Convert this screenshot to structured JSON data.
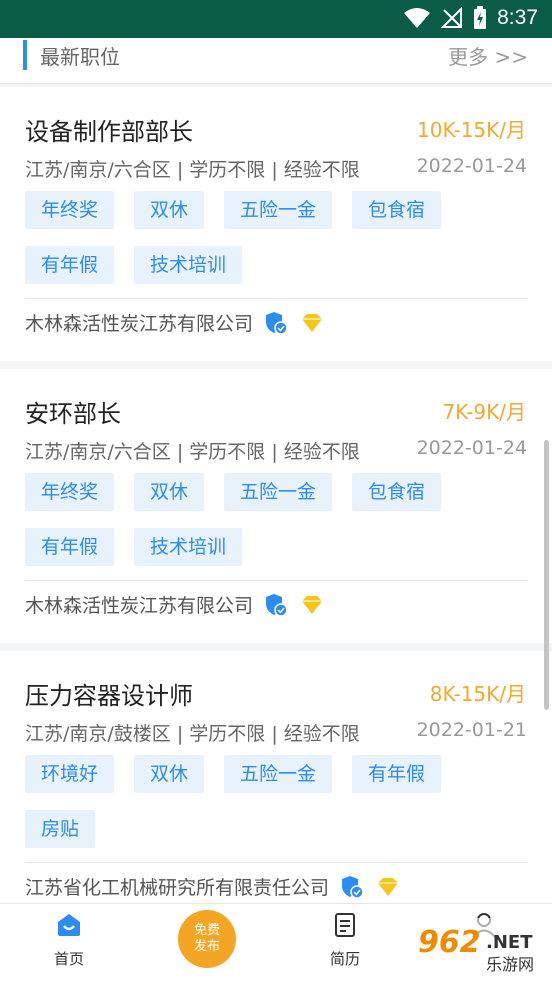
{
  "status_bar": {
    "time": "8:37"
  },
  "section": {
    "title": "最新职位",
    "more": "更多 >>"
  },
  "jobs": [
    {
      "title": "设备制作部部长",
      "salary": "10K-15K/月",
      "meta": "江苏/南京/六合区 | 学历不限 | 经验不限",
      "date": "2022-01-24",
      "tags": [
        "年终奖",
        "双休",
        "五险一金",
        "包食宿",
        "有年假",
        "技术培训"
      ],
      "company": "木林森活性炭江苏有限公司"
    },
    {
      "title": "安环部长",
      "salary": "7K-9K/月",
      "meta": "江苏/南京/六合区 | 学历不限 | 经验不限",
      "date": "2022-01-24",
      "tags": [
        "年终奖",
        "双休",
        "五险一金",
        "包食宿",
        "有年假",
        "技术培训"
      ],
      "company": "木林森活性炭江苏有限公司"
    },
    {
      "title": "压力容器设计师",
      "salary": "8K-15K/月",
      "meta": "江苏/南京/鼓楼区 | 学历不限 | 经验不限",
      "date": "2022-01-21",
      "tags": [
        "环境好",
        "双休",
        "五险一金",
        "有年假",
        "房贴"
      ],
      "company": "江苏省化工机械研究所有限责任公司"
    }
  ],
  "tabbar": {
    "home": "首页",
    "publish_line1": "免费",
    "publish_line2": "发布",
    "resume": "简历"
  },
  "watermark": {
    "brand": "962",
    "suffix": ".NET",
    "sub": "乐游网"
  },
  "colors": {
    "accent": "#2d8cf0",
    "salary": "#f4a732",
    "status_bar": "#0b5c47"
  }
}
